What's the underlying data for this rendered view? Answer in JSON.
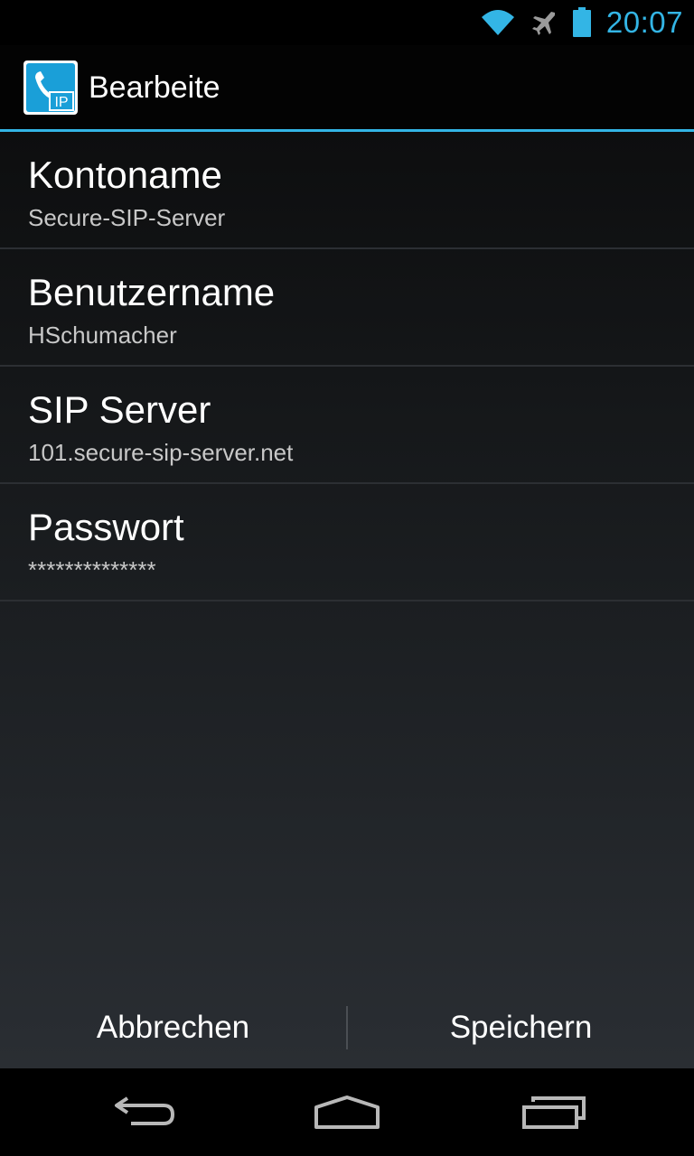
{
  "status_bar": {
    "time": "20:07",
    "icons": [
      "wifi-icon",
      "airplane-icon",
      "battery-icon"
    ],
    "accent_color": "#33b5e5"
  },
  "action_bar": {
    "title": "Bearbeite",
    "app_icon": "sip-phone-app-icon",
    "app_icon_text": "IP"
  },
  "preferences": [
    {
      "title": "Kontoname",
      "summary": "Secure-SIP-Server"
    },
    {
      "title": "Benutzername",
      "summary": "HSchumacher"
    },
    {
      "title": "SIP Server",
      "summary": "101.secure-sip-server.net"
    },
    {
      "title": "Passwort",
      "summary": "**************"
    }
  ],
  "buttons": {
    "cancel": "Abbrechen",
    "save": "Speichern"
  },
  "nav_bar": {
    "icons": [
      "back-icon",
      "home-icon",
      "recent-apps-icon"
    ]
  }
}
